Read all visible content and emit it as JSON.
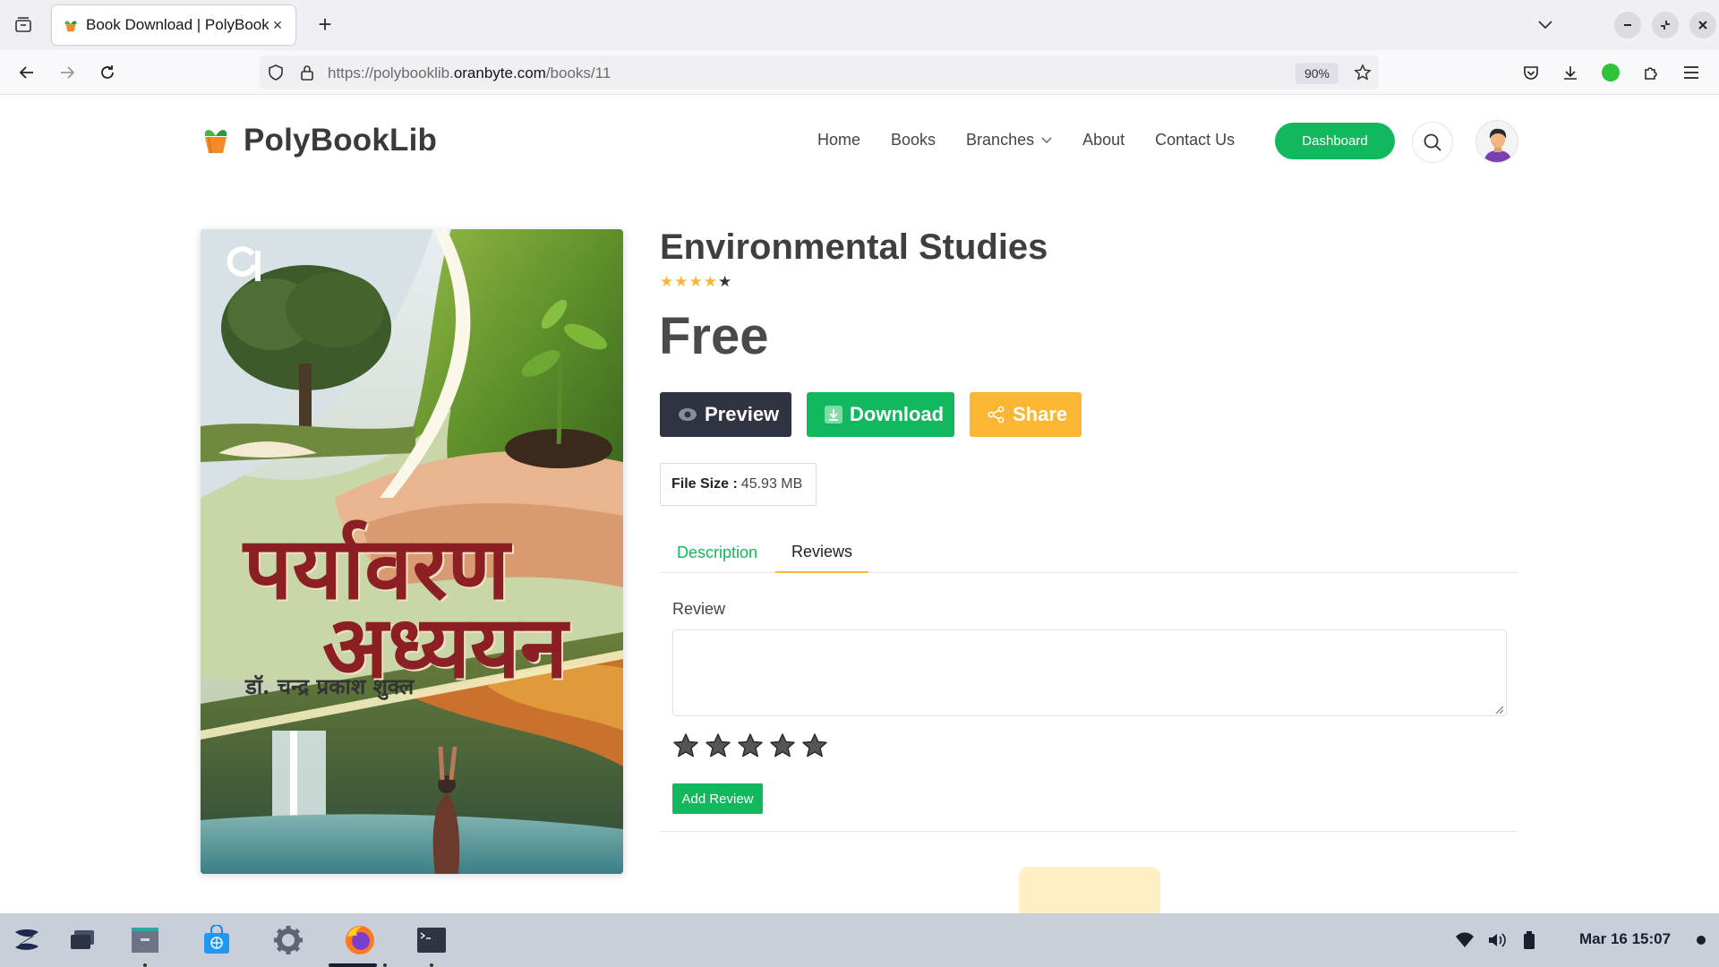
{
  "browser": {
    "tab_title": "Book Download | PolyBookLib",
    "url_prefix": "https://polybooklib.",
    "url_host": "oranbyte.com",
    "url_path": "/books/11",
    "zoom": "90%"
  },
  "site": {
    "logo": "PolyBookLib",
    "nav": {
      "home": "Home",
      "books": "Books",
      "branches": "Branches",
      "about": "About",
      "contact": "Contact Us"
    },
    "dashboard_label": "Dashboard"
  },
  "book": {
    "cover_title_line1": "पर्यावरण",
    "cover_title_line2": "अध्ययन",
    "cover_author": "डॉ. चन्द्र प्रकाश शुक्ल",
    "title": "Environmental Studies",
    "rating": 4,
    "rating_max": 5,
    "price": "Free",
    "preview_label": "Preview",
    "download_label": "Download",
    "share_label": "Share",
    "file_size_label": "File Size :",
    "file_size_value": "45.93 MB"
  },
  "tabs": {
    "description": "Description",
    "reviews": "Reviews",
    "active": "Reviews"
  },
  "review_form": {
    "label": "Review",
    "placeholder": "",
    "stars": 5,
    "submit_label": "Add Review"
  },
  "taskbar": {
    "clock": "Mar 16  15:07"
  },
  "colors": {
    "primary_green": "#12b85d",
    "share_orange": "#fbb634",
    "preview_dark": "#2f3342",
    "star_yellow": "#fbb634"
  }
}
